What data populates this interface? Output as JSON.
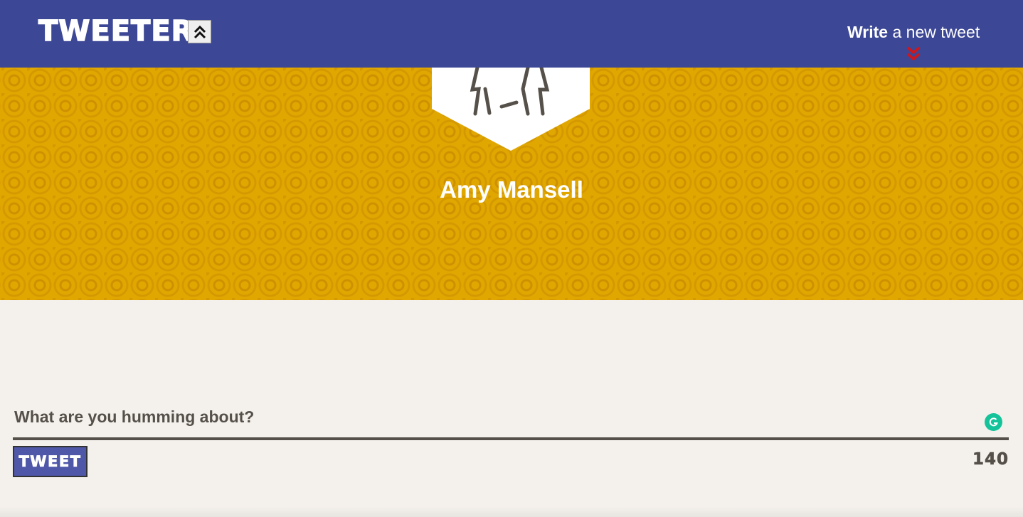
{
  "header": {
    "logo_text": "TWEETER",
    "scroll_top_icon": "double-chevron-up-icon",
    "compose_link": {
      "bold": "Write",
      "rest": " a new tweet"
    },
    "compose_icon": "double-chevron-down-icon",
    "accent_color": "#d0161b"
  },
  "profile": {
    "name": "Amy Mansell",
    "avatar_icon": "person-avatar-icon",
    "banner_color": "#e1a701"
  },
  "composer": {
    "placeholder": "What are you humming about?",
    "tweet_button": "TWEET",
    "char_counter": "140",
    "grammarly_icon": "grammarly-icon"
  },
  "colors": {
    "nav": "#3c4795",
    "button": "#4f57a8",
    "page": "#f4f1ec",
    "text": "#555049"
  }
}
